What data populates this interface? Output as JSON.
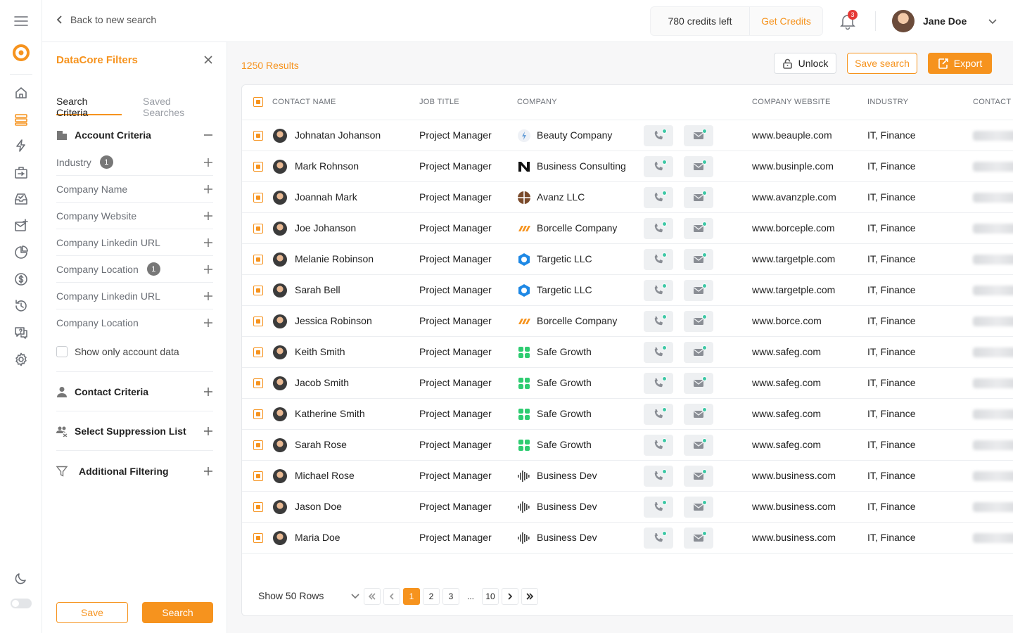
{
  "header": {
    "back_label": "Back to new search",
    "credits_left": "780 credits left",
    "get_credits": "Get Credits",
    "notifications_count": "3",
    "user_name": "Jane Doe"
  },
  "filters": {
    "title": "DataCore Filters",
    "tabs": [
      "Search Criteria",
      "Saved Searches"
    ],
    "account_criteria": "Account Criteria",
    "items": [
      {
        "label": "Industry",
        "count": "1"
      },
      {
        "label": "Company Name",
        "count": ""
      },
      {
        "label": "Company Website",
        "count": ""
      },
      {
        "label": "Company Linkedin URL",
        "count": ""
      },
      {
        "label": "Company Location",
        "count": "1"
      },
      {
        "label": "Company Linkedin URL",
        "count": ""
      },
      {
        "label": "Company Location",
        "count": ""
      }
    ],
    "show_only_account": "Show only account data",
    "contact_criteria": "Contact Criteria",
    "suppression_list": "Select Suppression List",
    "additional_filtering": "Additional Filtering",
    "save_label": "Save",
    "search_label": "Search"
  },
  "toolbar": {
    "results": "1250 Results",
    "unlock": "Unlock",
    "save_search": "Save search",
    "export": "Export"
  },
  "table": {
    "columns": [
      "CONTACT NAME",
      "JOB TITLE",
      "COMPANY",
      "COMPANY WEBSITE",
      "INDUSTRY",
      "CONTACT"
    ],
    "rows": [
      {
        "name": "Johnatan Johanson",
        "title": "Project Manager",
        "company": "Beauty Company",
        "logo": "beauty",
        "website": "www.beauple.com",
        "industry": "IT, Finance"
      },
      {
        "name": "Mark Rohnson",
        "title": "Project Manager",
        "company": "Business Consulting",
        "logo": "consulting",
        "website": "www.businple.com",
        "industry": "IT, Finance"
      },
      {
        "name": "Joannah Mark",
        "title": "Project Manager",
        "company": "Avanz  LLC",
        "logo": "avanz",
        "website": "www.avanzple.com",
        "industry": "IT, Finance"
      },
      {
        "name": "Joe Johanson",
        "title": "Project Manager",
        "company": "Borcelle Company",
        "logo": "borcelle",
        "website": "www.borceple.com",
        "industry": "IT, Finance"
      },
      {
        "name": "Melanie Robinson",
        "title": "Project Manager",
        "company": "Targetic LLC",
        "logo": "targetic",
        "website": "www.targetple.com",
        "industry": "IT, Finance"
      },
      {
        "name": "Sarah Bell",
        "title": "Project Manager",
        "company": "Targetic LLC",
        "logo": "targetic",
        "website": "www.targetple.com",
        "industry": "IT, Finance"
      },
      {
        "name": "Jessica Robinson",
        "title": "Project Manager",
        "company": "Borcelle Company",
        "logo": "borcelle",
        "website": "www.borce.com",
        "industry": "IT, Finance"
      },
      {
        "name": "Keith Smith",
        "title": "Project Manager",
        "company": "Safe Growth",
        "logo": "safegrowth",
        "website": "www.safeg.com",
        "industry": "IT, Finance"
      },
      {
        "name": "Jacob Smith",
        "title": "Project Manager",
        "company": "Safe Growth",
        "logo": "safegrowth",
        "website": "www.safeg.com",
        "industry": "IT, Finance"
      },
      {
        "name": "Katherine Smith",
        "title": "Project Manager",
        "company": "Safe Growth",
        "logo": "safegrowth",
        "website": "www.safeg.com",
        "industry": "IT, Finance"
      },
      {
        "name": "Sarah Rose",
        "title": "Project Manager",
        "company": "Safe Growth",
        "logo": "safegrowth",
        "website": "www.safeg.com",
        "industry": "IT, Finance"
      },
      {
        "name": "Michael Rose",
        "title": "Project Manager",
        "company": "Business Dev",
        "logo": "bizdev",
        "website": "www.business.com",
        "industry": "IT, Finance"
      },
      {
        "name": "Jason Doe",
        "title": "Project Manager",
        "company": "Business Dev",
        "logo": "bizdev",
        "website": "www.business.com",
        "industry": "IT, Finance"
      },
      {
        "name": "Maria Doe",
        "title": "Project Manager",
        "company": "Business Dev",
        "logo": "bizdev",
        "website": "www.business.com",
        "industry": "IT, Finance"
      }
    ]
  },
  "pagination": {
    "rows_label": "Show 50 Rows",
    "pages": [
      "1",
      "2",
      "3",
      "...",
      "10"
    ],
    "current": "1"
  },
  "colors": {
    "accent": "#f6931e",
    "status_dot": "#3ec7a5",
    "badge": "#e53935"
  }
}
